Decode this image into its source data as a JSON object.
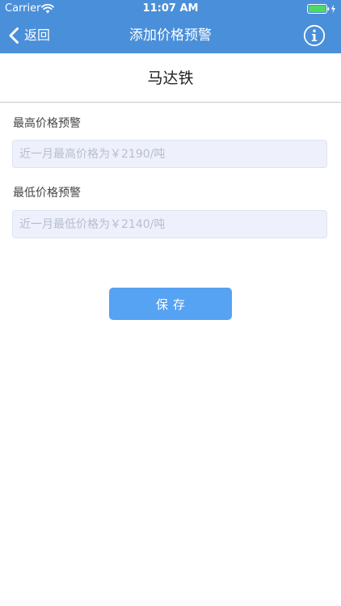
{
  "status_bar": {
    "carrier": "Carrier",
    "time": "11:07 AM",
    "wifi_icon": "wifi-icon",
    "battery_icon": "battery-charging-icon"
  },
  "nav": {
    "back_label": "返回",
    "back_icon": "chevron-left-icon",
    "title": "添加价格预警",
    "info_icon": "info-icon"
  },
  "product": {
    "name": "马达铁"
  },
  "form": {
    "max_label": "最高价格预警",
    "max_placeholder": "近一月最高价格为￥2190/吨",
    "min_label": "最低价格预警",
    "min_placeholder": "近一月最低价格为￥2140/吨",
    "save_label": "保存"
  },
  "colors": {
    "header_bg": "#4a8fd9",
    "input_bg": "#eef1fb",
    "button_bg": "#56a2f3",
    "battery_fill": "#4cd964"
  }
}
